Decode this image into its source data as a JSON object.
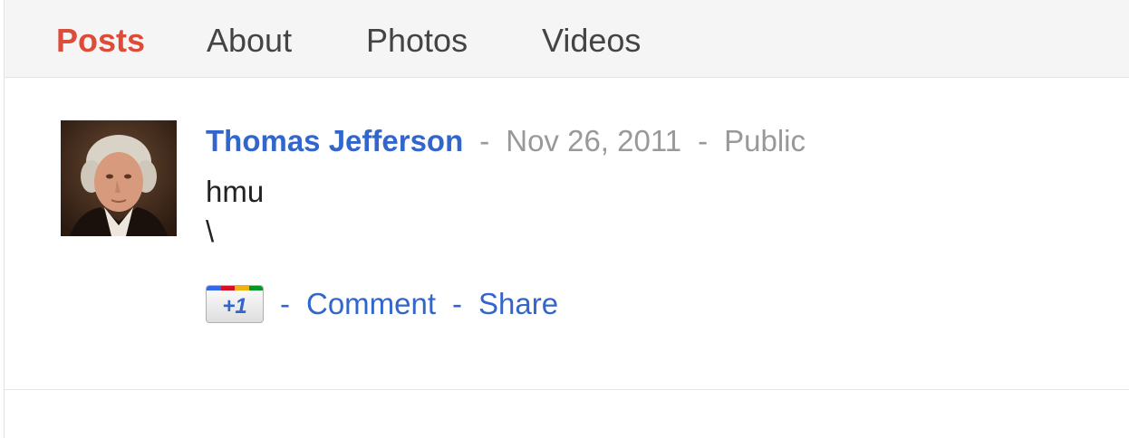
{
  "tabs": [
    {
      "label": "Posts",
      "active": true
    },
    {
      "label": "About",
      "active": false
    },
    {
      "label": "Photos",
      "active": false
    },
    {
      "label": "Videos",
      "active": false
    }
  ],
  "post": {
    "author": "Thomas Jefferson",
    "date": "Nov 26, 2011",
    "visibility": "Public",
    "separator": "-",
    "body_line1": "hmu",
    "body_line2": "\\",
    "avatar_icon": "portrait-avatar",
    "actions": {
      "plus_one_label": "+1",
      "comment_label": "Comment",
      "share_label": "Share",
      "separator": "-"
    }
  },
  "colors": {
    "active_tab": "#dd4b39",
    "link": "#3366cc",
    "meta_gray": "#999999",
    "tab_bar_bg": "#f5f5f5"
  }
}
